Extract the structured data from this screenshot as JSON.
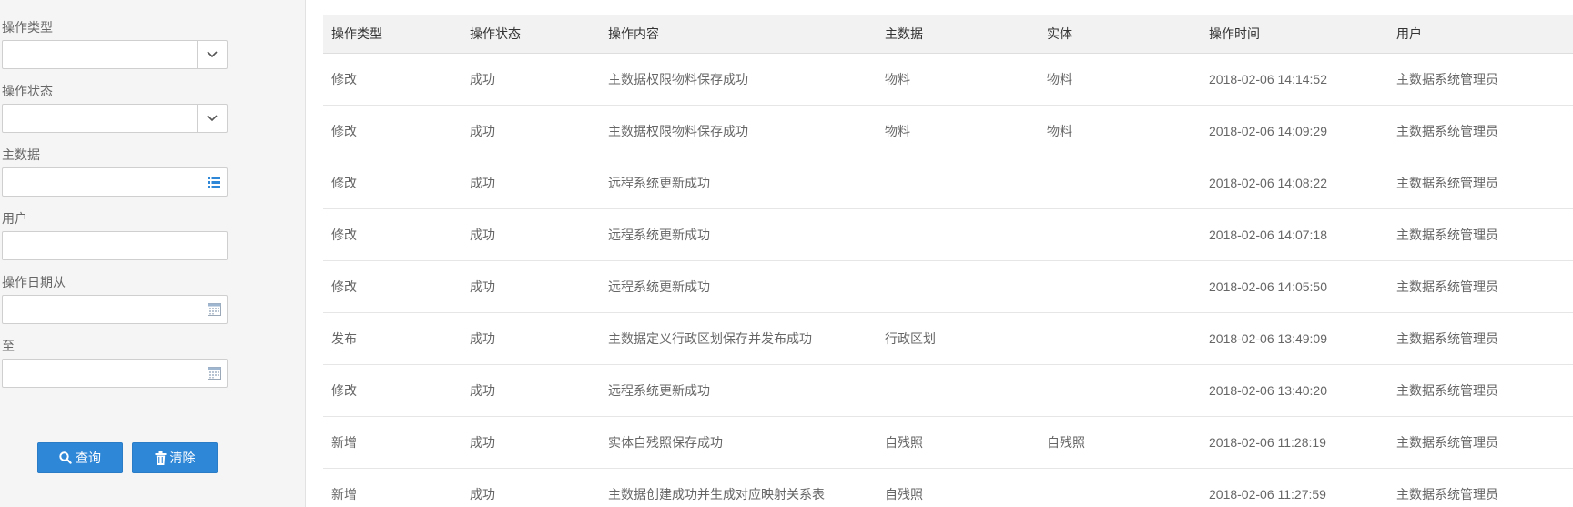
{
  "filters": {
    "op_type_label": "操作类型",
    "op_type_value": "",
    "op_status_label": "操作状态",
    "op_status_value": "",
    "master_data_label": "主数据",
    "master_data_value": "",
    "user_label": "用户",
    "user_value": "",
    "date_from_label": "操作日期从",
    "date_from_value": "",
    "date_to_label": "至",
    "date_to_value": "",
    "query_button": "查询",
    "clear_button": "清除"
  },
  "table": {
    "columns": [
      "操作类型",
      "操作状态",
      "操作内容",
      "主数据",
      "实体",
      "操作时间",
      "用户"
    ],
    "rows": [
      [
        "修改",
        "成功",
        "主数据权限物料保存成功",
        "物料",
        "物料",
        "2018-02-06 14:14:52",
        "主数据系统管理员"
      ],
      [
        "修改",
        "成功",
        "主数据权限物料保存成功",
        "物料",
        "物料",
        "2018-02-06 14:09:29",
        "主数据系统管理员"
      ],
      [
        "修改",
        "成功",
        "远程系统更新成功",
        "",
        "",
        "2018-02-06 14:08:22",
        "主数据系统管理员"
      ],
      [
        "修改",
        "成功",
        "远程系统更新成功",
        "",
        "",
        "2018-02-06 14:07:18",
        "主数据系统管理员"
      ],
      [
        "修改",
        "成功",
        "远程系统更新成功",
        "",
        "",
        "2018-02-06 14:05:50",
        "主数据系统管理员"
      ],
      [
        "发布",
        "成功",
        "主数据定义行政区划保存并发布成功",
        "行政区划",
        "",
        "2018-02-06 13:49:09",
        "主数据系统管理员"
      ],
      [
        "修改",
        "成功",
        "远程系统更新成功",
        "",
        "",
        "2018-02-06 13:40:20",
        "主数据系统管理员"
      ],
      [
        "新增",
        "成功",
        "实体自残照保存成功",
        "自残照",
        "自残照",
        "2018-02-06 11:28:19",
        "主数据系统管理员"
      ],
      [
        "新增",
        "成功",
        "主数据创建成功并生成对应映射关系表",
        "自残照",
        "",
        "2018-02-06 11:27:59",
        "主数据系统管理员"
      ]
    ]
  },
  "icons": {
    "caret": "chevron-down-icon",
    "list": "list-icon",
    "calendar": "calendar-icon",
    "search": "search-icon",
    "trash": "trash-icon"
  },
  "colors": {
    "primary_button": "#2f87d8",
    "list_icon": "#2f87d8",
    "sidebar_bg": "#f5f5f5",
    "header_bg": "#f2f2f2"
  }
}
